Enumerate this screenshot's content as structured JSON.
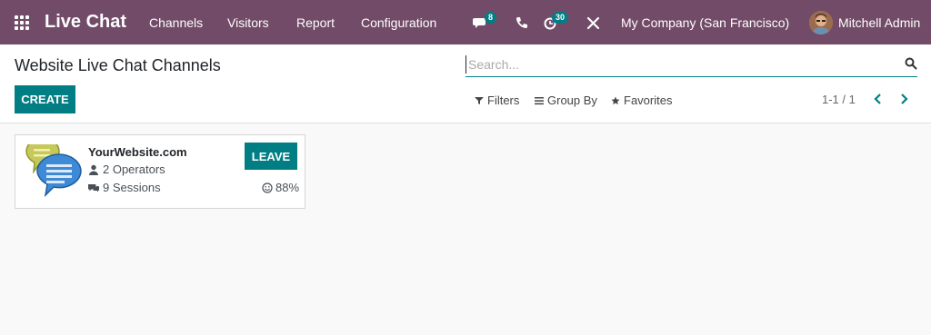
{
  "navbar": {
    "brand": "Live Chat",
    "menu": [
      {
        "label": "Channels"
      },
      {
        "label": "Visitors"
      },
      {
        "label": "Report"
      },
      {
        "label": "Configuration"
      }
    ],
    "messages_badge": "8",
    "activities_badge": "30",
    "company": "My Company (San Francisco)",
    "user": "Mitchell Admin"
  },
  "control_panel": {
    "title": "Website Live Chat Channels",
    "create_label": "CREATE",
    "search_placeholder": "Search...",
    "filters_label": "Filters",
    "group_by_label": "Group By",
    "favorites_label": "Favorites",
    "pager": "1-1 / 1"
  },
  "channels": [
    {
      "name": "YourWebsite.com",
      "operators": "2 Operators",
      "sessions": "9 Sessions",
      "action_label": "LEAVE",
      "rating": "88%"
    }
  ],
  "colors": {
    "navbar": "#714b67",
    "primary": "#017e84",
    "background": "#f9f9fa"
  },
  "icons": [
    "apps-icon",
    "messages-icon",
    "phone-icon",
    "activities-icon",
    "debug-icon",
    "search-icon",
    "filter-icon",
    "group-by-icon",
    "star-icon",
    "chevron-left-icon",
    "chevron-right-icon",
    "user-icon",
    "comments-icon",
    "smile-icon",
    "chat-bubbles-icon"
  ]
}
